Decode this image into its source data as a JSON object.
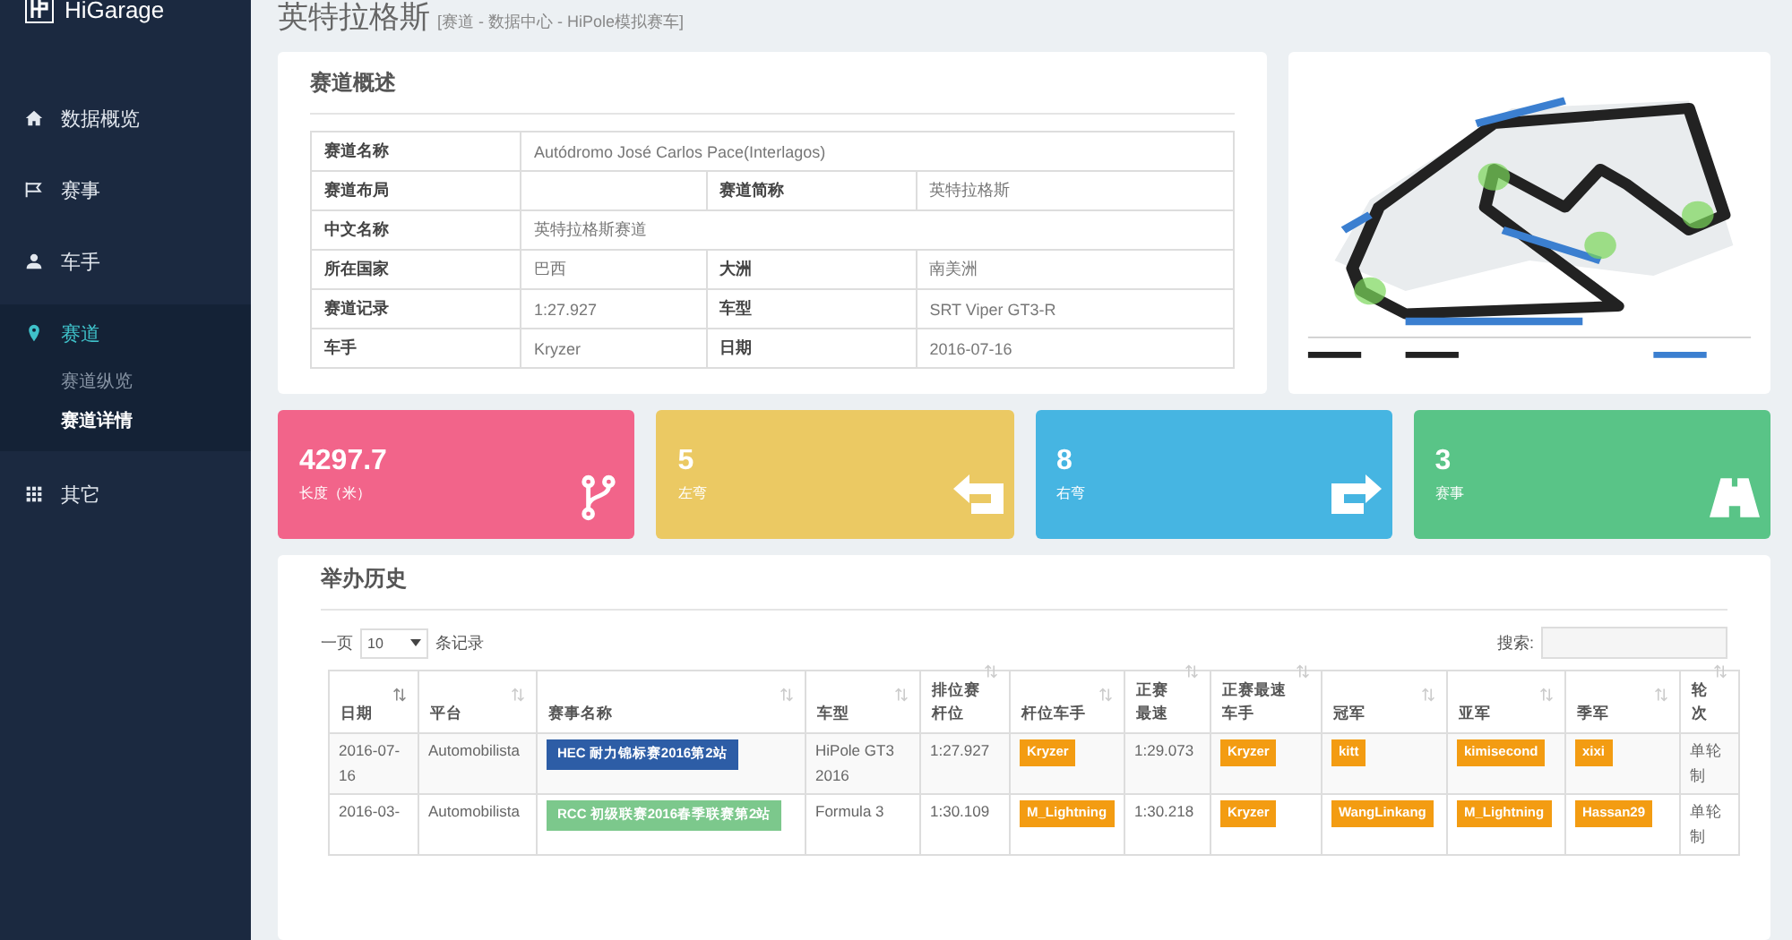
{
  "brand": "HiGarage",
  "sidebar": {
    "items": [
      {
        "label": "数据概览",
        "selected": false
      },
      {
        "label": "赛事",
        "selected": false
      },
      {
        "label": "车手",
        "selected": false
      },
      {
        "label": "赛道",
        "selected": true,
        "children": [
          {
            "label": "赛道纵览",
            "selected": false
          },
          {
            "label": "赛道详情",
            "selected": true
          }
        ]
      },
      {
        "label": "其它",
        "selected": false
      }
    ]
  },
  "page": {
    "title": "英特拉格斯",
    "breadcrumb": "[赛道 - 数据中心 - HiPole模拟赛车]"
  },
  "overview": {
    "title": "赛道概述",
    "rows": [
      [
        {
          "label": "赛道名称",
          "value": "Autódromo José Carlos Pace(Interlagos)"
        }
      ],
      [
        {
          "label": "赛道布局"
        },
        {
          "label": "赛道简称",
          "value": "英特拉格斯"
        }
      ],
      [
        {
          "label": "中文名称",
          "value": "英特拉格斯赛道"
        }
      ],
      [
        {
          "label": "所在国家",
          "value": "巴西"
        },
        {
          "label": "大洲",
          "value": "南美洲"
        }
      ],
      [
        {
          "label": "赛道记录",
          "value": "1:27.927"
        },
        {
          "label": "车型",
          "value": "SRT Viper GT3-R"
        }
      ],
      [
        {
          "label": "车手",
          "value": "Kryzer"
        },
        {
          "label": "日期",
          "value": "2016-07-16"
        }
      ]
    ]
  },
  "stats": [
    {
      "value": "4297.7",
      "label": "长度（米）",
      "color": "#f2648a",
      "kind": "fork"
    },
    {
      "value": "5",
      "label": "左弯",
      "color": "#ebc963",
      "kind": "left"
    },
    {
      "value": "8",
      "label": "右弯",
      "color": "#46b5e2",
      "kind": "right"
    },
    {
      "value": "3",
      "label": "赛事",
      "color": "#59c487",
      "kind": "road"
    }
  ],
  "history": {
    "title": "举办历史",
    "length_prefix": "一页",
    "length_value": "10",
    "length_suffix": "条记录",
    "search_label": "搜索:",
    "columns": [
      {
        "label": "日期",
        "sorted": true
      },
      {
        "label": "平台",
        "sorted": false
      },
      {
        "label": "赛事名称",
        "sorted": false
      },
      {
        "label": "车型",
        "sorted": false
      },
      {
        "label": "排位赛杆位",
        "sorted": false
      },
      {
        "label": "杆位车手",
        "sorted": false
      },
      {
        "label": "正赛最速",
        "sorted": false
      },
      {
        "label": "正赛最速车手",
        "sorted": false
      },
      {
        "label": "冠军",
        "sorted": false
      },
      {
        "label": "亚军",
        "sorted": false
      },
      {
        "label": "季军",
        "sorted": false
      },
      {
        "label": "轮次",
        "sorted": false
      }
    ],
    "rows": [
      {
        "date": "2016-07-16",
        "platform": "Automobilista",
        "event": "HEC 耐力锦标赛2016第2站",
        "color": "#2d5da6",
        "car": "HiPole GT3 2016",
        "pole_time": "1:27.927",
        "pole_driver": "Kryzer",
        "fastest": "1:29.073",
        "fastest_driver": "Kryzer",
        "first": "kitt",
        "second": "kimisecond",
        "third": "xixi",
        "format": "单轮制"
      },
      {
        "date": "2016-03-",
        "platform": "Automobilista",
        "event": "RCC 初级联赛2016春季联赛第2站",
        "color": "#7cc88c",
        "car": "Formula 3",
        "pole_time": "1:30.109",
        "pole_driver": "M_Lightning",
        "fastest": "1:30.218",
        "fastest_driver": "Kryzer",
        "first": "WangLinkang",
        "second": "M_Lightning",
        "third": "Hassan29",
        "format": "单轮制"
      }
    ]
  }
}
